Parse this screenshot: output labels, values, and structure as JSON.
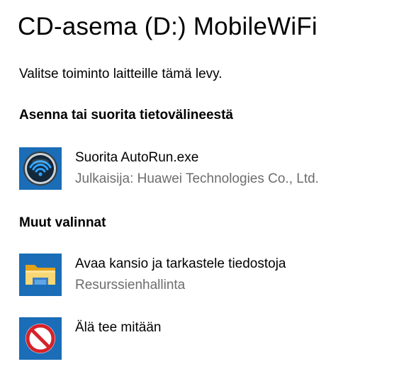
{
  "dialog": {
    "title": "CD-asema (D:) MobileWiFi",
    "prompt": "Valitse toiminto laitteille tämä levy."
  },
  "sections": {
    "install": {
      "heading": "Asenna tai suorita tietovälineestä",
      "options": [
        {
          "label": "Suorita AutoRun.exe",
          "sublabel": "Julkaisija: Huawei Technologies Co., Ltd.",
          "icon": "wifi-autorun-icon"
        }
      ]
    },
    "other": {
      "heading": "Muut valinnat",
      "options": [
        {
          "label": "Avaa kansio ja tarkastele tiedostoja",
          "sublabel": "Resurssienhallinta",
          "icon": "folder-icon"
        },
        {
          "label": "Älä tee mitään",
          "icon": "no-action-icon"
        }
      ]
    }
  },
  "colors": {
    "icon_tile": "#1a6db6",
    "secondary_text": "#6d6d6d",
    "prohibition_red": "#d6222a"
  }
}
